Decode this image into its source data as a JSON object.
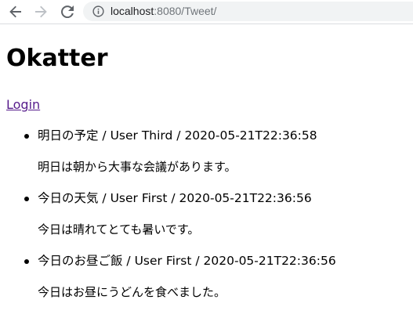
{
  "browser": {
    "url_host": "localhost",
    "url_rest": ":8080/Tweet/"
  },
  "page": {
    "title": "Okatter",
    "login_link": "Login"
  },
  "tweets": [
    {
      "header": "明日の予定 / User Third / 2020-05-21T22:36:58",
      "body": "明日は朝から大事な会議があります。"
    },
    {
      "header": "今日の天気 / User First / 2020-05-21T22:36:56",
      "body": "今日は晴れてとても暑いです。"
    },
    {
      "header": "今日のお昼ご飯 / User First / 2020-05-21T22:36:56",
      "body": "今日はお昼にうどんを食べました。"
    }
  ],
  "icons": {
    "back": "back-arrow-icon",
    "forward": "forward-arrow-icon",
    "reload": "reload-icon",
    "info": "info-icon"
  }
}
